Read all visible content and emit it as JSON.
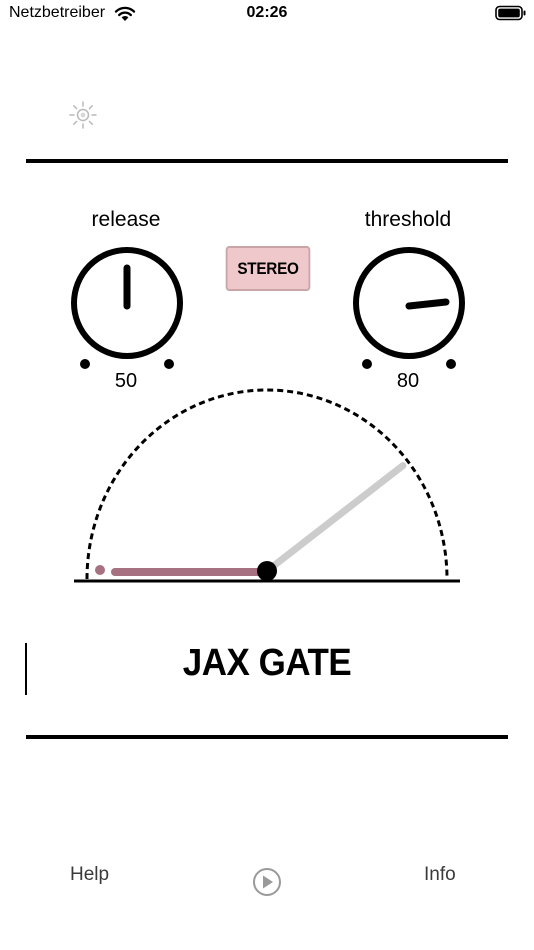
{
  "status_bar": {
    "carrier": "Netzbetreiber",
    "time": "02:26",
    "icons": [
      "wifi-icon",
      "battery-icon"
    ]
  },
  "toolbar": {
    "icon": "brightness-icon"
  },
  "controls": {
    "release": {
      "label": "release",
      "value": "50"
    },
    "threshold": {
      "label": "threshold",
      "value": "80"
    },
    "stereo_label": "STEREO"
  },
  "meter": {
    "gate_level": 0.45,
    "needle_level": 0.79,
    "colors": {
      "gate": "#a67180",
      "needle": "#cccccc",
      "arc": "#000000"
    }
  },
  "plugin": {
    "title": "JAX GATE"
  },
  "footer": {
    "help_label": "Help",
    "info_label": "Info",
    "play_icon": "play-circle-icon"
  }
}
